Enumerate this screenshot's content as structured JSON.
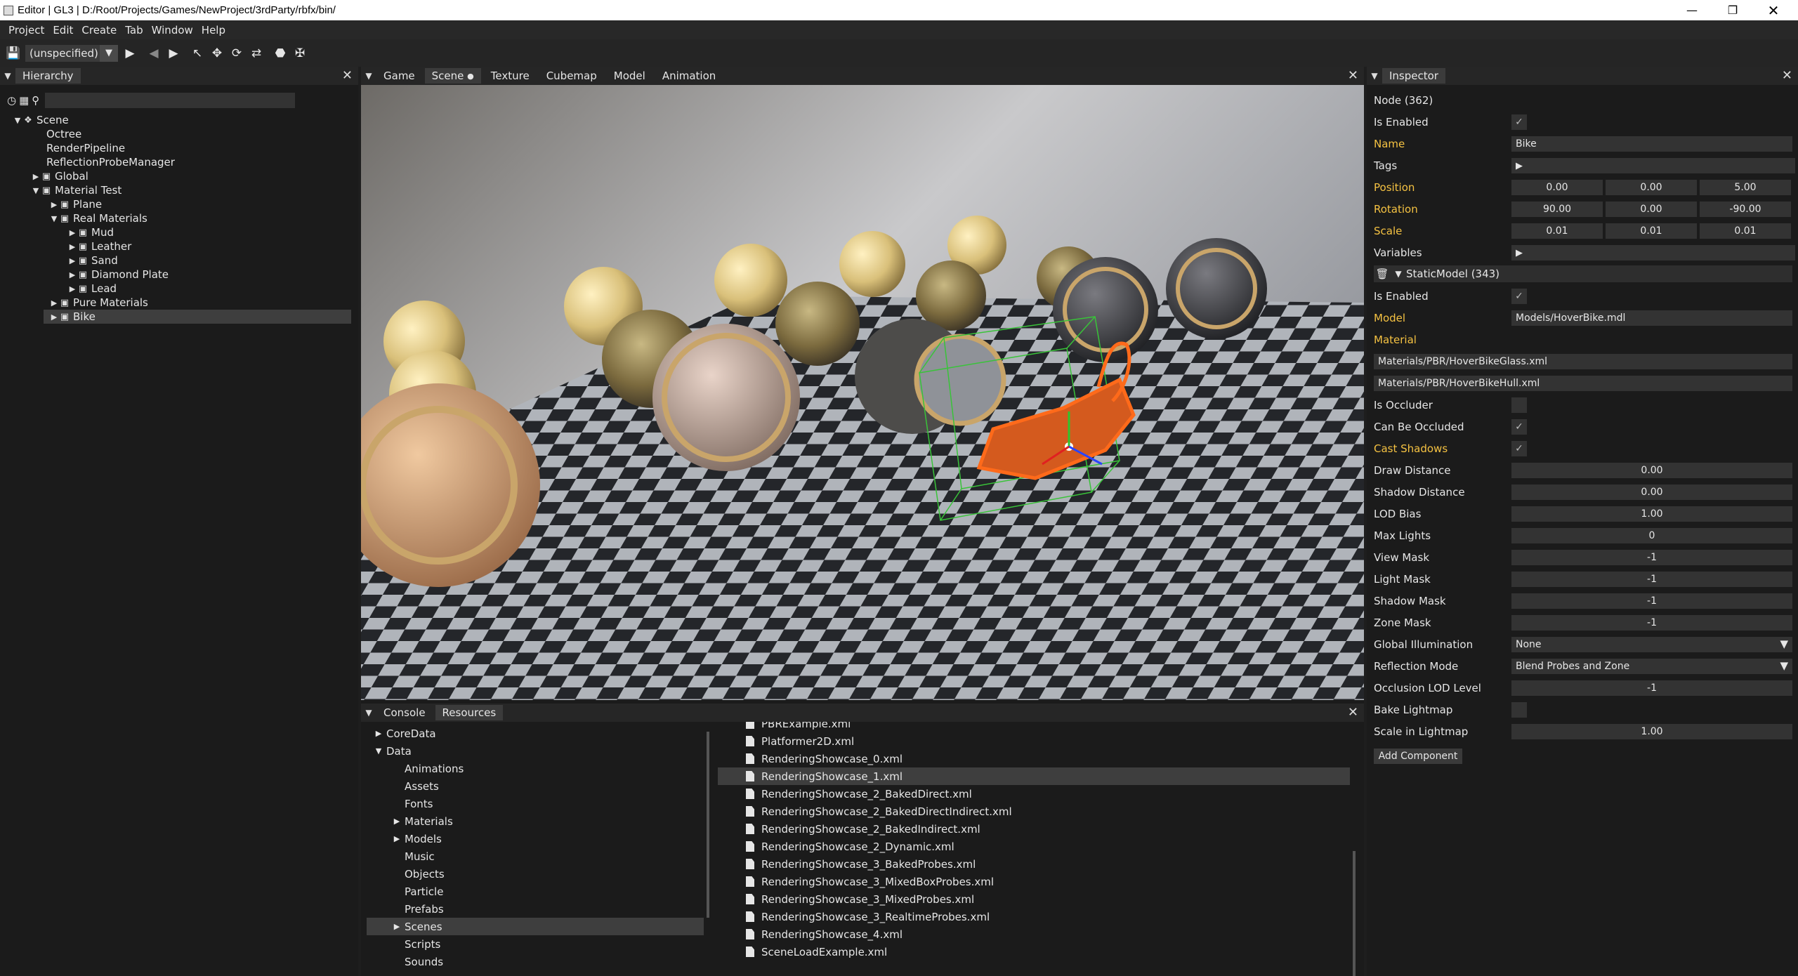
{
  "window": {
    "title": "Editor | GL3 | D:/Root/Projects/Games/NewProject/3rdParty/rbfx/bin/"
  },
  "menu": [
    "Project",
    "Edit",
    "Create",
    "Tab",
    "Window",
    "Help"
  ],
  "toolbar": {
    "config": "(unspecified)"
  },
  "hierarchy": {
    "tab": "Hierarchy",
    "tree": [
      {
        "label": "Scene",
        "depth": 0,
        "arrow": "down",
        "icon": "scene"
      },
      {
        "label": "Octree",
        "depth": 1,
        "arrow": "",
        "icon": ""
      },
      {
        "label": "RenderPipeline",
        "depth": 1,
        "arrow": "",
        "icon": ""
      },
      {
        "label": "ReflectionProbeManager",
        "depth": 1,
        "arrow": "",
        "icon": ""
      },
      {
        "label": "Global",
        "depth": 1,
        "arrow": "right",
        "icon": "node"
      },
      {
        "label": "Material Test",
        "depth": 1,
        "arrow": "down",
        "icon": "node"
      },
      {
        "label": "Plane",
        "depth": 2,
        "arrow": "right",
        "icon": "node"
      },
      {
        "label": "Real Materials",
        "depth": 2,
        "arrow": "down",
        "icon": "node"
      },
      {
        "label": "Mud",
        "depth": 3,
        "arrow": "right",
        "icon": "node"
      },
      {
        "label": "Leather",
        "depth": 3,
        "arrow": "right",
        "icon": "node"
      },
      {
        "label": "Sand",
        "depth": 3,
        "arrow": "right",
        "icon": "node"
      },
      {
        "label": "Diamond Plate",
        "depth": 3,
        "arrow": "right",
        "icon": "node"
      },
      {
        "label": "Lead",
        "depth": 3,
        "arrow": "right",
        "icon": "node"
      },
      {
        "label": "Pure Materials",
        "depth": 2,
        "arrow": "right",
        "icon": "node"
      },
      {
        "label": "Bike",
        "depth": 2,
        "arrow": "right",
        "icon": "node",
        "selected": true
      }
    ]
  },
  "view_tabs": [
    "Game",
    "Scene",
    "Texture",
    "Cubemap",
    "Model",
    "Animation"
  ],
  "view_tabs_modified": "●",
  "bottom_tabs": [
    "Console",
    "Resources"
  ],
  "resources": {
    "folders": [
      {
        "label": "CoreData",
        "depth": 0,
        "arrow": "right"
      },
      {
        "label": "Data",
        "depth": 0,
        "arrow": "down"
      },
      {
        "label": "Animations",
        "depth": 1,
        "arrow": ""
      },
      {
        "label": "Assets",
        "depth": 1,
        "arrow": ""
      },
      {
        "label": "Fonts",
        "depth": 1,
        "arrow": ""
      },
      {
        "label": "Materials",
        "depth": 1,
        "arrow": "right"
      },
      {
        "label": "Models",
        "depth": 1,
        "arrow": "right"
      },
      {
        "label": "Music",
        "depth": 1,
        "arrow": ""
      },
      {
        "label": "Objects",
        "depth": 1,
        "arrow": ""
      },
      {
        "label": "Particle",
        "depth": 1,
        "arrow": ""
      },
      {
        "label": "Prefabs",
        "depth": 1,
        "arrow": ""
      },
      {
        "label": "Scenes",
        "depth": 1,
        "arrow": "right",
        "selected": true
      },
      {
        "label": "Scripts",
        "depth": 1,
        "arrow": ""
      },
      {
        "label": "Sounds",
        "depth": 1,
        "arrow": ""
      }
    ],
    "files": [
      {
        "label": "PBRExample.xml"
      },
      {
        "label": "Platformer2D.xml"
      },
      {
        "label": "RenderingShowcase_0.xml"
      },
      {
        "label": "RenderingShowcase_1.xml",
        "selected": true
      },
      {
        "label": "RenderingShowcase_2_BakedDirect.xml"
      },
      {
        "label": "RenderingShowcase_2_BakedDirectIndirect.xml"
      },
      {
        "label": "RenderingShowcase_2_BakedIndirect.xml"
      },
      {
        "label": "RenderingShowcase_2_Dynamic.xml"
      },
      {
        "label": "RenderingShowcase_3_BakedProbes.xml"
      },
      {
        "label": "RenderingShowcase_3_MixedBoxProbes.xml"
      },
      {
        "label": "RenderingShowcase_3_MixedProbes.xml"
      },
      {
        "label": "RenderingShowcase_3_RealtimeProbes.xml"
      },
      {
        "label": "RenderingShowcase_4.xml"
      },
      {
        "label": "SceneLoadExample.xml"
      }
    ]
  },
  "inspector": {
    "tab": "Inspector",
    "node_title": "Node (362)",
    "is_enabled_label": "Is Enabled",
    "name_label": "Name",
    "name_value": "Bike",
    "tags_label": "Tags",
    "position_label": "Position",
    "position": [
      "0.00",
      "0.00",
      "5.00"
    ],
    "rotation_label": "Rotation",
    "rotation": [
      "90.00",
      "0.00",
      "-90.00"
    ],
    "scale_label": "Scale",
    "scale": [
      "0.01",
      "0.01",
      "0.01"
    ],
    "variables_label": "Variables",
    "component_title": "StaticModel (343)",
    "comp_enabled_label": "Is Enabled",
    "model_label": "Model",
    "model_value": "Models/HoverBike.mdl",
    "material_label": "Material",
    "materials": [
      "Materials/PBR/HoverBikeGlass.xml",
      "Materials/PBR/HoverBikeHull.xml"
    ],
    "is_occluder_label": "Is Occluder",
    "can_be_occluded_label": "Can Be Occluded",
    "cast_shadows_label": "Cast Shadows",
    "draw_distance_label": "Draw Distance",
    "draw_distance": "0.00",
    "shadow_distance_label": "Shadow Distance",
    "shadow_distance": "0.00",
    "lod_bias_label": "LOD Bias",
    "lod_bias": "1.00",
    "max_lights_label": "Max Lights",
    "max_lights": "0",
    "view_mask_label": "View Mask",
    "view_mask": "-1",
    "light_mask_label": "Light Mask",
    "light_mask": "-1",
    "shadow_mask_label": "Shadow Mask",
    "shadow_mask": "-1",
    "zone_mask_label": "Zone Mask",
    "zone_mask": "-1",
    "gi_label": "Global Illumination",
    "gi_value": "None",
    "reflection_label": "Reflection Mode",
    "reflection_value": "Blend Probes and Zone",
    "occlusion_lod_label": "Occlusion LOD Level",
    "occlusion_lod": "-1",
    "bake_lightmap_label": "Bake Lightmap",
    "scale_lightmap_label": "Scale in Lightmap",
    "scale_lightmap": "1.00",
    "add_component": "Add Component"
  },
  "colors": {
    "highlight_label": "#f5c242",
    "selection": "#3e3e3e",
    "panel_bg": "#1b1b1b"
  }
}
